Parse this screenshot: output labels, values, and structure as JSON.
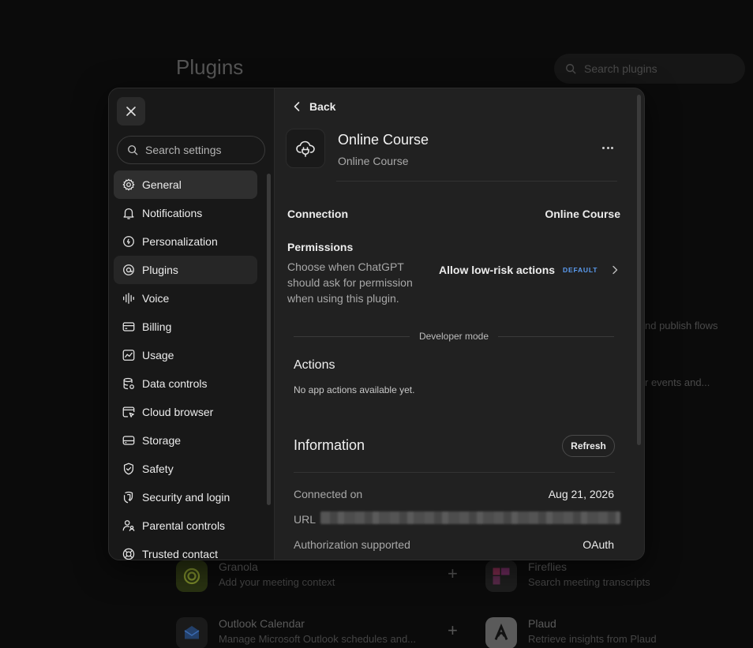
{
  "background": {
    "title": "Plugins",
    "search_placeholder": "Search plugins",
    "peek_text_1": "nd publish flows",
    "peek_text_2": "r events and...",
    "cards": [
      {
        "title": "Granola",
        "desc": "Add your meeting context"
      },
      {
        "title": "Fireflies",
        "desc": "Search meeting transcripts"
      },
      {
        "title": "Outlook Calendar",
        "desc": "Manage Microsoft Outlook schedules and..."
      },
      {
        "title": "Plaud",
        "desc": "Retrieve insights from Plaud"
      }
    ],
    "plus_symbol": "+"
  },
  "sidebar": {
    "search_placeholder": "Search settings",
    "items": [
      {
        "label": "General",
        "icon": "gear-icon"
      },
      {
        "label": "Notifications",
        "icon": "bell-icon"
      },
      {
        "label": "Personalization",
        "icon": "personalization-icon"
      },
      {
        "label": "Plugins",
        "icon": "plugins-icon"
      },
      {
        "label": "Voice",
        "icon": "waveform-icon"
      },
      {
        "label": "Billing",
        "icon": "credit-card-icon"
      },
      {
        "label": "Usage",
        "icon": "chart-icon"
      },
      {
        "label": "Data controls",
        "icon": "database-icon"
      },
      {
        "label": "Cloud browser",
        "icon": "browser-icon"
      },
      {
        "label": "Storage",
        "icon": "storage-icon"
      },
      {
        "label": "Safety",
        "icon": "shield-icon"
      },
      {
        "label": "Security and login",
        "icon": "security-icon"
      },
      {
        "label": "Parental controls",
        "icon": "parental-icon"
      },
      {
        "label": "Trusted contact",
        "icon": "lifebuoy-icon"
      }
    ]
  },
  "detail": {
    "back_label": "Back",
    "plugin_name": "Online Course",
    "plugin_subtitle": "Online Course",
    "connection_label": "Connection",
    "connection_value": "Online Course",
    "permissions_label": "Permissions",
    "permissions_desc": "Choose when ChatGPT should ask for permission when using this plugin.",
    "permissions_value": "Allow low-risk actions",
    "permissions_badge": "DEFAULT",
    "developer_mode_label": "Developer mode",
    "actions_title": "Actions",
    "actions_empty": "No app actions available yet.",
    "information_title": "Information",
    "refresh_label": "Refresh",
    "connected_on_label": "Connected on",
    "connected_on_value": "Aug 21, 2026",
    "url_label": "URL",
    "auth_label": "Authorization supported",
    "auth_value": "OAuth"
  },
  "colors": {
    "accent_badge": "#5b9cf0",
    "modal_bg": "#212121",
    "sidebar_bg": "#181818",
    "active_item": "#2f2f2f"
  }
}
